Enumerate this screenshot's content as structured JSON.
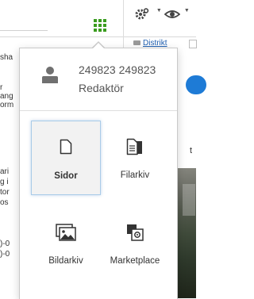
{
  "header": {
    "apps_icon": "grid-icon",
    "settings_icon": "gear-icon",
    "view_icon": "eye-icon"
  },
  "breadcrumb": {
    "label": "Distrikt"
  },
  "background_left_text": [
    "sha",
    "r",
    "ang",
    "orm",
    "ari",
    "g i",
    "tor",
    "os",
    ")-0",
    ")-0"
  ],
  "background_right_letter": "t",
  "user": {
    "id": "249823 249823",
    "role": "Redaktör",
    "icon": "user-icon"
  },
  "apps": [
    {
      "label": "Sidor",
      "icon": "document-icon",
      "selected": true
    },
    {
      "label": "Filarkiv",
      "icon": "file-archive-icon",
      "selected": false
    },
    {
      "label": "Bildarkiv",
      "icon": "image-archive-icon",
      "selected": false
    },
    {
      "label": "Marketplace",
      "icon": "marketplace-icon",
      "selected": false
    }
  ],
  "colors": {
    "accent_green": "#3a9c1e",
    "selected_border": "#a9cbe8",
    "link_blue": "#1f5fb0"
  }
}
